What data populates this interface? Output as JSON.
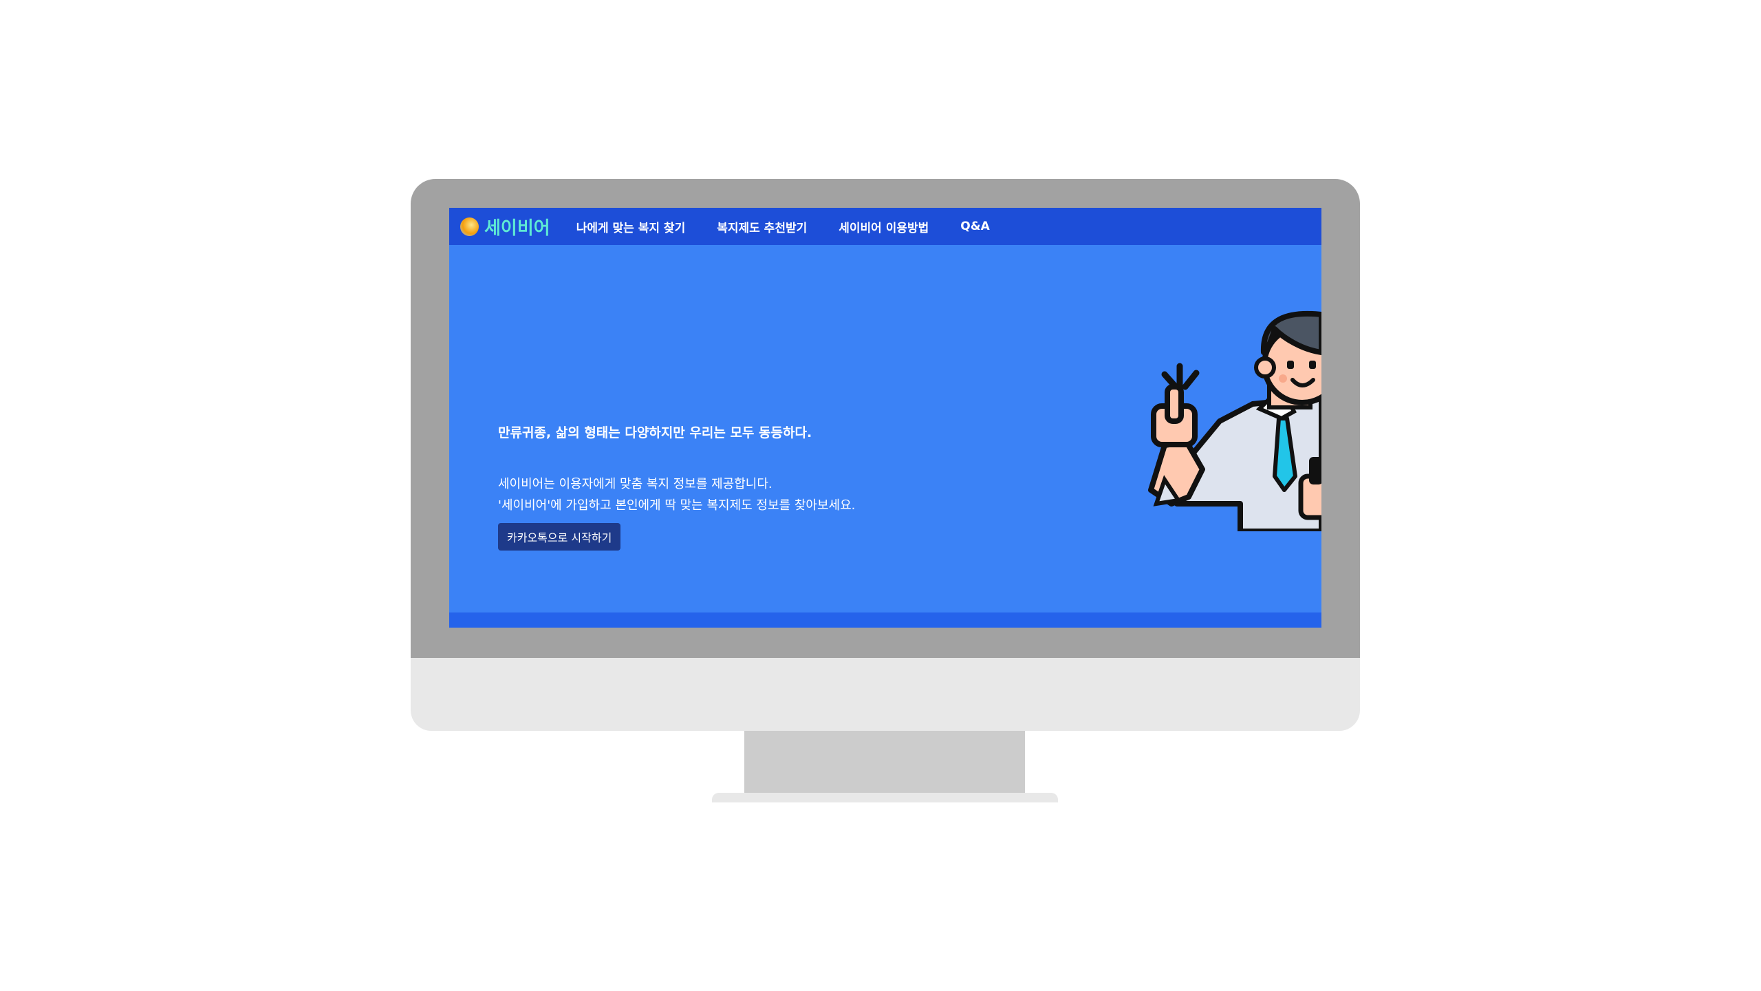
{
  "brand": {
    "name": "세이비어"
  },
  "nav": {
    "items": [
      {
        "label": "나에게 맞는 복지 찾기"
      },
      {
        "label": "복지제도 추천받기"
      },
      {
        "label": "세이비어 이용방법"
      },
      {
        "label": "Q&A"
      }
    ]
  },
  "hero": {
    "slogan": "만류귀종, 삶의 형태는 다양하지만 우리는 모두 동등하다.",
    "description_lines": [
      "세이비어는 이용자에게 맞춤 복지 정보를 제공합니다.",
      "'세이비어'에 가입하고 본인에게 딱 맞는 복지제도 정보를 찾아보세요."
    ],
    "cta_label": "카카오톡으로 시작하기"
  },
  "icons": {
    "logo": "sun-logo-icon",
    "illustration": "thumbs-up-man-illustration"
  },
  "colors": {
    "screen_background": "#3b82f6",
    "navbar": "#1d4ed8",
    "brand_text": "#5eead4",
    "cta_button": "#1e3a8a",
    "monitor_frame": "#a2a2a2",
    "monitor_chin": "#e8e8e8",
    "monitor_stand": "#cccccc"
  }
}
